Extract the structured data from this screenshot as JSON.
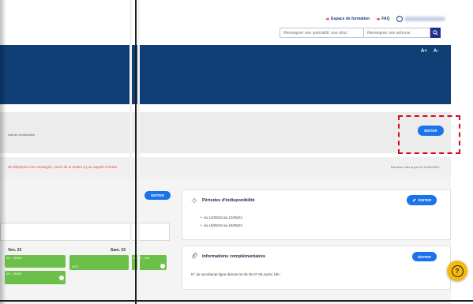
{
  "header": {
    "links": [
      {
        "label": "Espace de formation"
      },
      {
        "label": "FAQ"
      }
    ],
    "search": {
      "specialty_placeholder": "Renseigner une spécialité, une struc",
      "address_placeholder": "Renseigner une adresse"
    },
    "font_controls": {
      "increase": "A+",
      "decrease": "A-"
    }
  },
  "status": {
    "text": "rfait de réclamation",
    "edit_label": "ÉDITER"
  },
  "warning": {
    "text": "de téléphone non renseigné, merci de le mettre à jour auprès d        Ordre",
    "last_update": "Dernière mise à jour le 21/09/2021"
  },
  "schedule": {
    "edit_label": "ÉDITER",
    "days": [
      {
        "label": "Ven. 22",
        "slots": [
          "00 - 13h30",
          "05 - 18h05"
        ]
      },
      {
        "label": "Sam. 23",
        "slots": [
          "10h10 - 12h",
          ""
        ]
      }
    ],
    "extra_slot_label": "0/12"
  },
  "unavailability": {
    "title": "Périodes d'indisponibilité",
    "edit_label": "ÉDITER",
    "periods": [
      "du 12/09/23 au 12/09/23",
      "du 19/09/23 au 19/09/23"
    ]
  },
  "additional_info": {
    "title": "Informations complémentaires",
    "edit_label": "ÉDITER",
    "text": "N° de secrétariat ligne directe 04 05 06 07 08 Après 18h :"
  },
  "help": {
    "label": "?"
  },
  "colors": {
    "primary": "#0f3f75",
    "button": "#1a73e8",
    "slot": "#6cc04a",
    "warning": "#e3493c",
    "highlight": "#d10a1c",
    "help": "#f6b911"
  }
}
